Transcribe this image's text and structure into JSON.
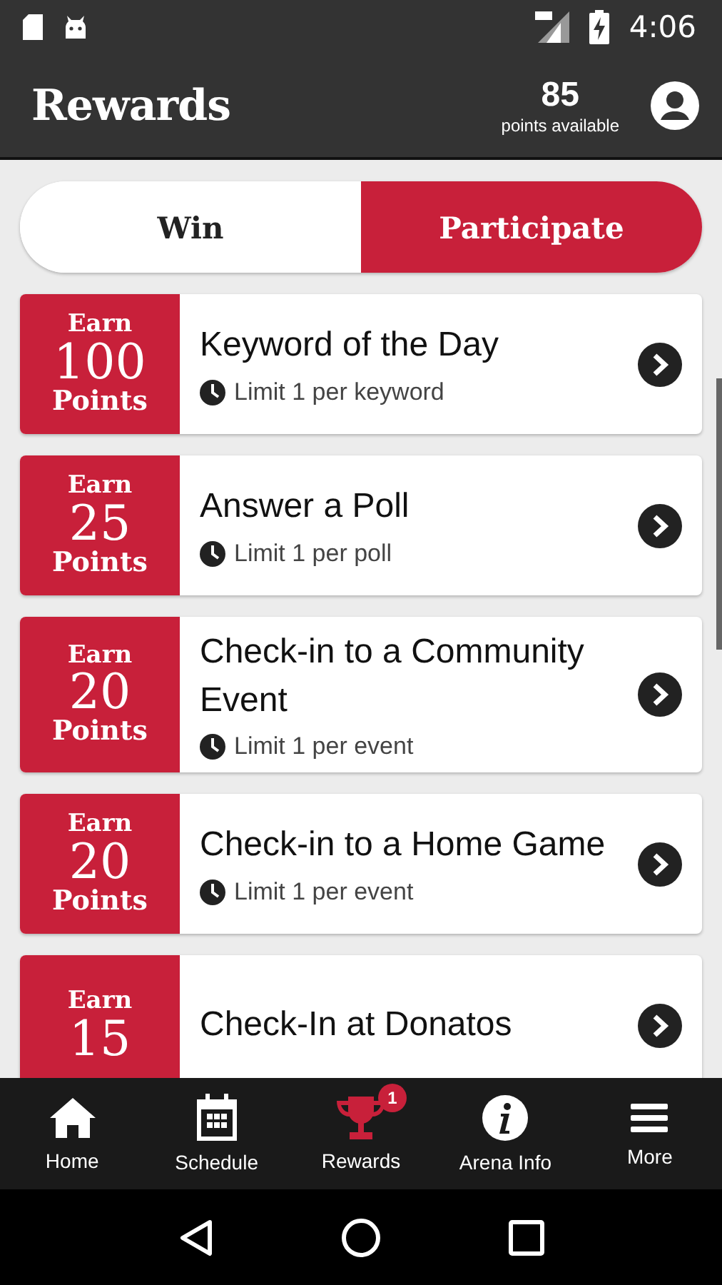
{
  "status_bar": {
    "time": "4:06"
  },
  "header": {
    "title": "Rewards",
    "points": "85",
    "points_label": "points available"
  },
  "tabs": [
    {
      "label": "Win",
      "selected": false
    },
    {
      "label": "Participate",
      "selected": true
    }
  ],
  "rewards": [
    {
      "earn": "Earn",
      "points": "100",
      "points_label": "Points",
      "title": "Keyword of the Day",
      "limit": "Limit 1 per keyword"
    },
    {
      "earn": "Earn",
      "points": "25",
      "points_label": "Points",
      "title": "Answer a Poll",
      "limit": "Limit 1 per poll"
    },
    {
      "earn": "Earn",
      "points": "20",
      "points_label": "Points",
      "title": "Check-in to a Community Event",
      "limit": "Limit 1 per event"
    },
    {
      "earn": "Earn",
      "points": "20",
      "points_label": "Points",
      "title": "Check-in to a Home Game",
      "limit": "Limit 1 per event"
    },
    {
      "earn": "Earn",
      "points": "15",
      "title": "Check-In at Donatos"
    }
  ],
  "bottom_nav": [
    {
      "kind": "home",
      "label": "Home",
      "selected": false
    },
    {
      "kind": "calendar",
      "label": "Schedule",
      "selected": false
    },
    {
      "kind": "trophy",
      "label": "Rewards",
      "selected": true,
      "badge": "1"
    },
    {
      "kind": "info",
      "label": "Arena Info",
      "selected": false
    },
    {
      "kind": "menu",
      "label": "More",
      "selected": false
    }
  ]
}
